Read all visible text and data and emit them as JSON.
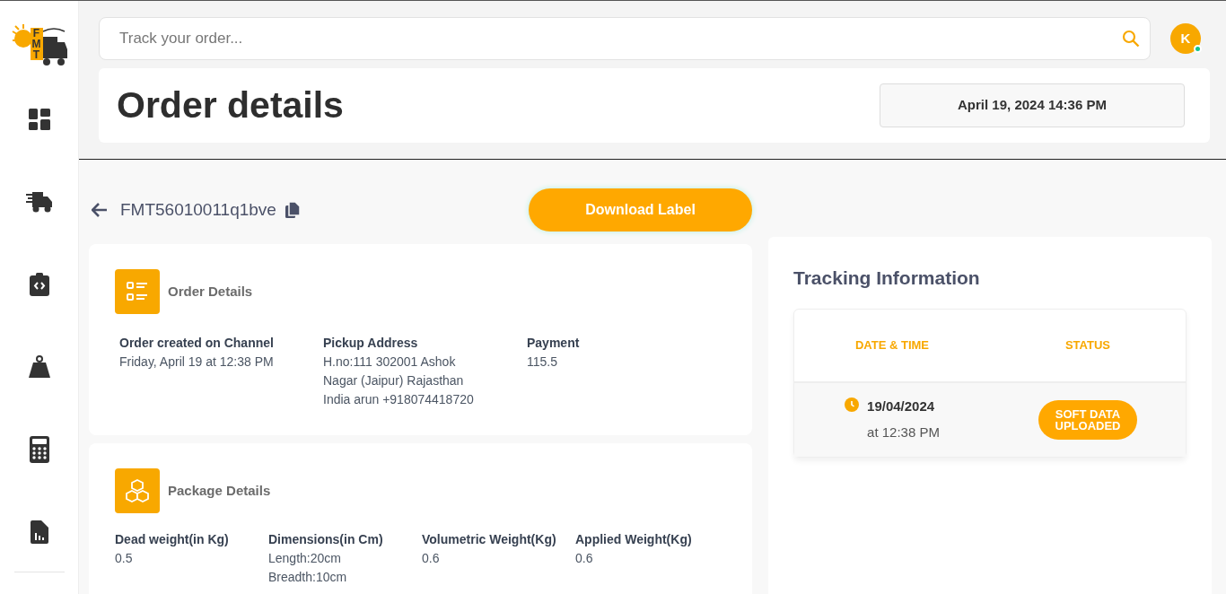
{
  "logo": {
    "letters": [
      "F",
      "M",
      "T"
    ]
  },
  "sidebar": {
    "items": [
      {
        "kind": "dashboard"
      },
      {
        "kind": "truck"
      },
      {
        "kind": "clipboard"
      },
      {
        "kind": "weight"
      },
      {
        "kind": "calculator"
      },
      {
        "kind": "report"
      }
    ]
  },
  "search": {
    "placeholder": "Track your order..."
  },
  "avatar": {
    "initial": "K",
    "online": true
  },
  "header": {
    "title": "Order details",
    "datetime": "April 19, 2024 14:36 PM"
  },
  "order": {
    "id": "FMT56010011q1bve",
    "download_button": "Download Label"
  },
  "order_details": {
    "title": "Order Details",
    "fields": [
      {
        "label": "Order created on Channel",
        "lines": [
          "Friday, April 19 at 12:38 PM"
        ]
      },
      {
        "label": "Pickup Address",
        "lines": [
          "H.no:111 302001 Ashok",
          "Nagar (Jaipur) Rajasthan",
          "India arun +918074418720"
        ]
      },
      {
        "label": "Payment",
        "lines": [
          "115.5"
        ]
      }
    ]
  },
  "package_details": {
    "title": "Package Details",
    "fields": [
      {
        "label": "Dead weight(in Kg)",
        "lines": [
          "0.5"
        ]
      },
      {
        "label": "Dimensions(in Cm)",
        "lines": [
          "Length:20cm",
          "Breadth:10cm"
        ]
      },
      {
        "label": "Volumetric Weight(Kg)",
        "lines": [
          "0.6"
        ]
      },
      {
        "label": "Applied Weight(Kg)",
        "lines": [
          "0.6"
        ]
      }
    ]
  },
  "tracking": {
    "title": "Tracking Information",
    "columns": [
      "DATE & TIME",
      "STATUS"
    ],
    "rows": [
      {
        "date": "19/04/2024",
        "time": "at 12:38 PM",
        "status": "SOFT DATA UPLOADED"
      }
    ]
  }
}
